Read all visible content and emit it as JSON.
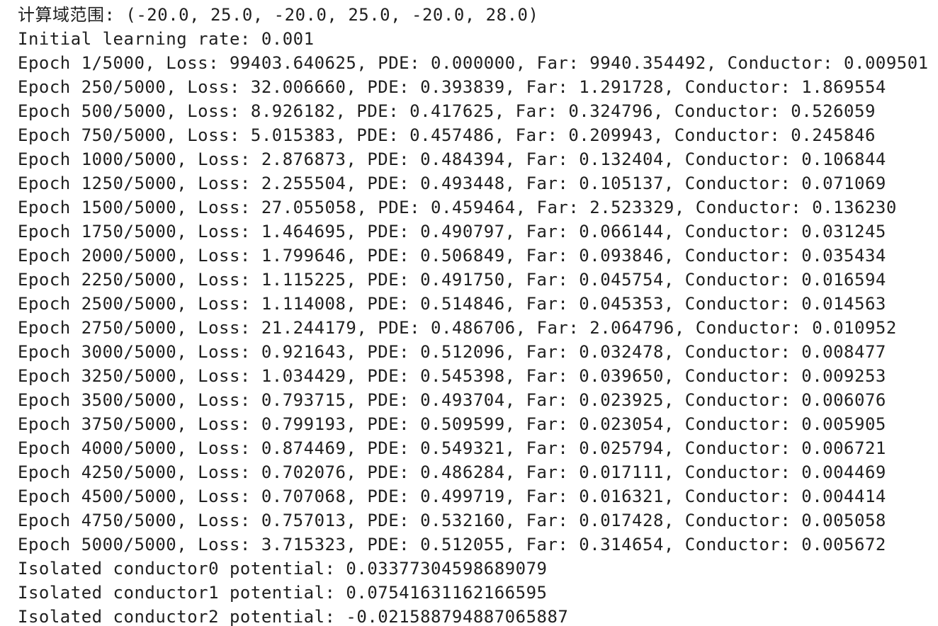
{
  "output_lines": [
    "计算域范围: (-20.0, 25.0, -20.0, 25.0, -20.0, 28.0)",
    "Initial learning rate: 0.001",
    "Epoch 1/5000, Loss: 99403.640625, PDE: 0.000000, Far: 9940.354492, Conductor: 0.009501",
    "Epoch 250/5000, Loss: 32.006660, PDE: 0.393839, Far: 1.291728, Conductor: 1.869554",
    "Epoch 500/5000, Loss: 8.926182, PDE: 0.417625, Far: 0.324796, Conductor: 0.526059",
    "Epoch 750/5000, Loss: 5.015383, PDE: 0.457486, Far: 0.209943, Conductor: 0.245846",
    "Epoch 1000/5000, Loss: 2.876873, PDE: 0.484394, Far: 0.132404, Conductor: 0.106844",
    "Epoch 1250/5000, Loss: 2.255504, PDE: 0.493448, Far: 0.105137, Conductor: 0.071069",
    "Epoch 1500/5000, Loss: 27.055058, PDE: 0.459464, Far: 2.523329, Conductor: 0.136230",
    "Epoch 1750/5000, Loss: 1.464695, PDE: 0.490797, Far: 0.066144, Conductor: 0.031245",
    "Epoch 2000/5000, Loss: 1.799646, PDE: 0.506849, Far: 0.093846, Conductor: 0.035434",
    "Epoch 2250/5000, Loss: 1.115225, PDE: 0.491750, Far: 0.045754, Conductor: 0.016594",
    "Epoch 2500/5000, Loss: 1.114008, PDE: 0.514846, Far: 0.045353, Conductor: 0.014563",
    "Epoch 2750/5000, Loss: 21.244179, PDE: 0.486706, Far: 2.064796, Conductor: 0.010952",
    "Epoch 3000/5000, Loss: 0.921643, PDE: 0.512096, Far: 0.032478, Conductor: 0.008477",
    "Epoch 3250/5000, Loss: 1.034429, PDE: 0.545398, Far: 0.039650, Conductor: 0.009253",
    "Epoch 3500/5000, Loss: 0.793715, PDE: 0.493704, Far: 0.023925, Conductor: 0.006076",
    "Epoch 3750/5000, Loss: 0.799193, PDE: 0.509599, Far: 0.023054, Conductor: 0.005905",
    "Epoch 4000/5000, Loss: 0.874469, PDE: 0.549321, Far: 0.025794, Conductor: 0.006721",
    "Epoch 4250/5000, Loss: 0.702076, PDE: 0.486284, Far: 0.017111, Conductor: 0.004469",
    "Epoch 4500/5000, Loss: 0.707068, PDE: 0.499719, Far: 0.016321, Conductor: 0.004414",
    "Epoch 4750/5000, Loss: 0.757013, PDE: 0.532160, Far: 0.017428, Conductor: 0.005058",
    "Epoch 5000/5000, Loss: 3.715323, PDE: 0.512055, Far: 0.314654, Conductor: 0.005672",
    "Isolated conductor0 potential: 0.03377304598689079",
    "Isolated conductor1 potential: 0.07541631162166595",
    "Isolated conductor2 potential: -0.021588794887065887"
  ],
  "colors": {
    "background": "#ffffff",
    "text": "#1f1f1f"
  }
}
